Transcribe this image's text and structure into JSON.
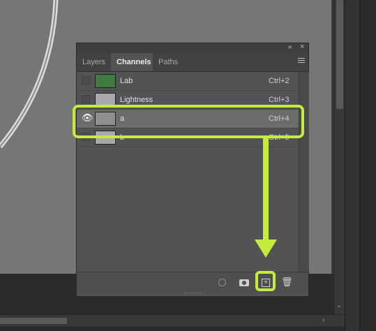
{
  "panel": {
    "collapse_icon": "«",
    "close_icon": "×",
    "tabs": [
      {
        "label": "Layers",
        "active": false
      },
      {
        "label": "Channels",
        "active": true
      },
      {
        "label": "Paths",
        "active": false
      }
    ]
  },
  "channels": [
    {
      "name": "Lab",
      "shortcut": "Ctrl+2",
      "visible": false,
      "selected": false,
      "thumb": "lab-color"
    },
    {
      "name": "Lightness",
      "shortcut": "Ctrl+3",
      "visible": false,
      "selected": false,
      "thumb": "grayscale"
    },
    {
      "name": "a",
      "shortcut": "Ctrl+4",
      "visible": true,
      "selected": true,
      "thumb": "grayscale"
    },
    {
      "name": "b",
      "shortcut": "Ctrl+5",
      "visible": false,
      "selected": false,
      "thumb": "grayscale"
    }
  ],
  "footer": {
    "buttons": [
      "load-selection-icon",
      "save-selection-mask-icon",
      "new-channel-icon",
      "trash-icon"
    ],
    "new_channel_glyph": "+",
    "trash_glyph": "🗑"
  },
  "annotation": {
    "color": "#c3ec3b"
  },
  "scroll": {
    "down_glyph": "⌄",
    "right_glyph": "›"
  },
  "eye_glyph": "👁"
}
